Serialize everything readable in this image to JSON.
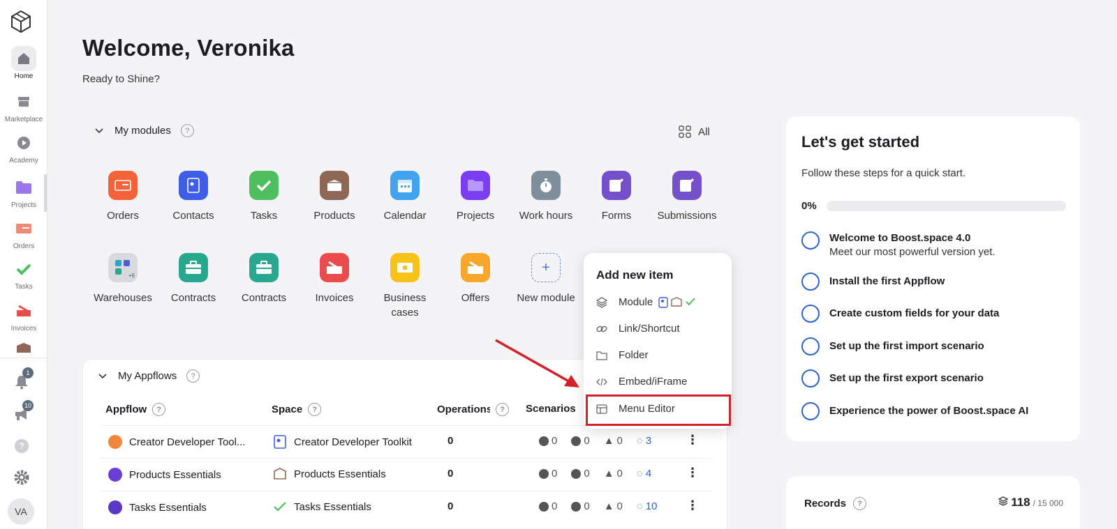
{
  "header": {
    "title": "Welcome, Veronika",
    "subtitle": "Ready to Shine?"
  },
  "sidebar": {
    "items": [
      {
        "label": "Home",
        "icon": "home-icon"
      },
      {
        "label": "Marketplace",
        "icon": "store-icon"
      },
      {
        "label": "Academy",
        "icon": "play-icon"
      },
      {
        "label": "Projects",
        "icon": "folder-icon"
      },
      {
        "label": "Orders",
        "icon": "orders-icon"
      },
      {
        "label": "Tasks",
        "icon": "check-icon"
      },
      {
        "label": "Invoices",
        "icon": "invoice-icon"
      }
    ],
    "notifications_badge": "1",
    "announcements_badge": "10",
    "help_glyph": "?",
    "avatar_initials": "VA"
  },
  "modules": {
    "heading": "My modules",
    "help_glyph": "?",
    "all_label": "All",
    "items": [
      {
        "label": "Orders",
        "color": "#f4623a"
      },
      {
        "label": "Contacts",
        "color": "#3f5de6"
      },
      {
        "label": "Tasks",
        "color": "#4fbe5f"
      },
      {
        "label": "Products",
        "color": "#8e6757"
      },
      {
        "label": "Calendar",
        "color": "#42a3ef"
      },
      {
        "label": "Projects",
        "color": "#7b3ef0"
      },
      {
        "label": "Work hours",
        "color": "#7f8e9b"
      },
      {
        "label": "Forms",
        "color": "#7450cb"
      },
      {
        "label": "Submissions",
        "color": "#7450cb"
      },
      {
        "label": "Warehouses",
        "color": "#d8dadf"
      },
      {
        "label": "Contracts",
        "color": "#29a88f"
      },
      {
        "label": "Contracts",
        "color": "#29a88f"
      },
      {
        "label": "Invoices",
        "color": "#ea4b4d"
      },
      {
        "label": "Business cases",
        "color": "#f7c21a"
      },
      {
        "label": "Offers",
        "color": "#f7a72a"
      }
    ],
    "new_module_label": "New module",
    "new_module_glyph": "+",
    "warehouses_overflow": "+6"
  },
  "appflows": {
    "heading": "My Appflows",
    "help_glyph": "?",
    "columns": [
      "Appflow",
      "Space",
      "Operations",
      "Scenarios"
    ],
    "rows": [
      {
        "appflow": "Creator Developer Tool...",
        "space": "Creator Developer Toolkit",
        "operations": "0",
        "running": "0",
        "paused": "0",
        "warnings": "0",
        "scenarios": "3",
        "badge_color": "#f0873c"
      },
      {
        "appflow": "Products Essentials",
        "space": "Products Essentials",
        "operations": "0",
        "running": "0",
        "paused": "0",
        "warnings": "0",
        "scenarios": "4",
        "badge_color": "#6b3fd6"
      },
      {
        "appflow": "Tasks Essentials",
        "space": "Tasks Essentials",
        "operations": "0",
        "running": "0",
        "paused": "0",
        "warnings": "0",
        "scenarios": "10",
        "badge_color": "#5a36c9"
      }
    ],
    "kebab_glyph": "⋮"
  },
  "popup": {
    "title": "Add new item",
    "items": [
      "Module",
      "Link/Shortcut",
      "Folder",
      "Embed/iFrame",
      "Menu Editor"
    ]
  },
  "get_started": {
    "title": "Let's get started",
    "subtitle": "Follow these steps for a quick start.",
    "progress_label": "0%",
    "progress": 0,
    "steps": [
      {
        "title": "Welcome to Boost.space 4.0",
        "desc": "Meet our most powerful version yet."
      },
      {
        "title": "Install the first Appflow",
        "desc": ""
      },
      {
        "title": "Create custom fields for your data",
        "desc": ""
      },
      {
        "title": "Set up the first import scenario",
        "desc": ""
      },
      {
        "title": "Set up the first export scenario",
        "desc": ""
      },
      {
        "title": "Experience the power of Boost.space AI",
        "desc": ""
      }
    ]
  },
  "records": {
    "title": "Records",
    "help_glyph": "?",
    "count": "118",
    "total": "/ 15 000"
  },
  "colors": {
    "accent": "#2e63c6",
    "highlight": "#d3202a"
  }
}
